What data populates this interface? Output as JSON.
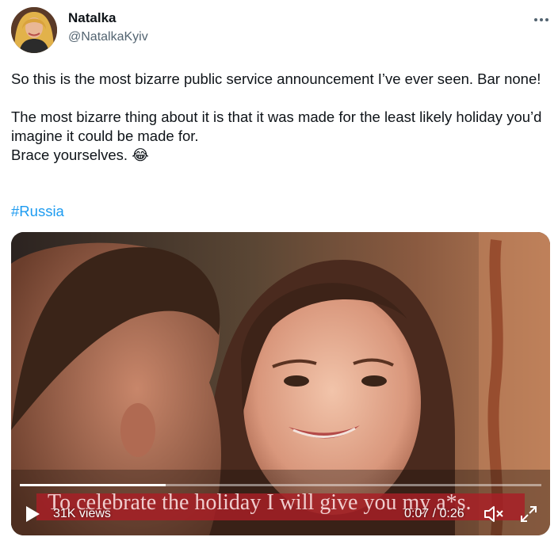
{
  "author": {
    "name": "Natalka",
    "handle": "@NatalkaKyiv"
  },
  "more_icon": "more-horizontal-icon",
  "tweet": {
    "line1": "So this is the most bizarre public service announcement I’ve ever seen. Bar none!",
    "line2": "The most bizarre thing about it is that it was made for the least likely holiday you’d imagine it could be made for.",
    "line3_text": "Brace yourselves. ",
    "line3_emoji": "😂",
    "hashtag": "#Russia"
  },
  "video": {
    "subtitle": "To celebrate the holiday I will give you my a*s.",
    "views": "31K views",
    "time": "0:07 / 0:26",
    "progress": 0.28,
    "icons": [
      "play-icon",
      "mute-icon",
      "fullscreen-icon"
    ]
  }
}
